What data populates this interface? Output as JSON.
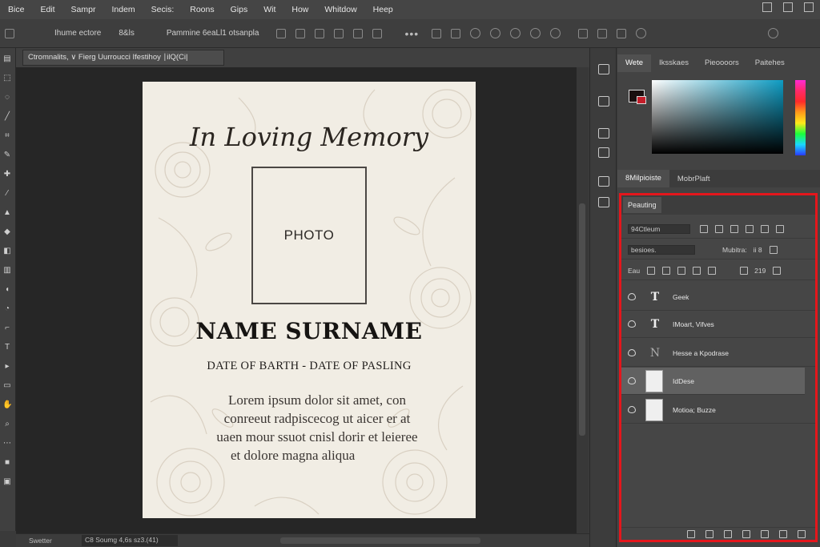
{
  "menu": {
    "items": [
      "Bice",
      "Edit",
      "Sampr",
      "Indem",
      "Secis:",
      "Roons",
      "Gips",
      "Wit",
      "How",
      "Whitdow",
      "Heep"
    ]
  },
  "options_bar": {
    "preset_text": "Ihume ectore",
    "mode_text": "8&ls",
    "align_text": "Pammine 6eaLl1 otsanpla"
  },
  "document": {
    "tab_title": "Ctromnalits,  ∨  Fierg  Uurroucci Ifestihoy  ∣ilQ(Ci|"
  },
  "memorial_card": {
    "title": "In Loving Memory",
    "photo_label": "PHOTO",
    "name": "NAME SURNAME",
    "dates": "DATE OF BARTH - DATE OF  PASLING",
    "body_lines": [
      "Lorem ipsum dolor sit amet, con",
      "conreeut radpiscecog ut aicer er at",
      "uaen mour ssuot cnisl dorir et leieree",
      "et dolore magna aliqua"
    ],
    "colors": {
      "paper": "#f1ede4",
      "ink": "#161412",
      "floral": "#d8cfc1"
    }
  },
  "status_bar": {
    "zoom": "Swetter",
    "doc_info": "C8 Soumg 4,6s sz3.(41)"
  },
  "color_panel": {
    "tabs": [
      "Wete",
      "Iksskaes",
      "Pieoooors",
      "Paitehes"
    ],
    "foreground": "#1a0f0f",
    "background": "#c41e2a",
    "field_hue": "#0e9cc3"
  },
  "library_panel": {
    "tabs": [
      "8Milpioiste",
      "MobrPlaft"
    ]
  },
  "layers_panel": {
    "tab": "Peauting",
    "filter_value": "94Ctleum",
    "blend_value": "besioes.",
    "opacity_label": "Mubitra:",
    "opacity_value": "ii 8",
    "lock_label": "Eau",
    "fill_value": "219",
    "layers": [
      {
        "name": "Geek",
        "type": "T"
      },
      {
        "name": "IMoart, Vifves",
        "type": "T"
      },
      {
        "name": "Hesse a Kpodrase",
        "type": "N"
      },
      {
        "name": "IdDese",
        "type": "thumb"
      },
      {
        "name": "Motioa; Buzze",
        "type": "thumb"
      }
    ],
    "selected_index": 3,
    "highlight_color": "#e4161c"
  }
}
